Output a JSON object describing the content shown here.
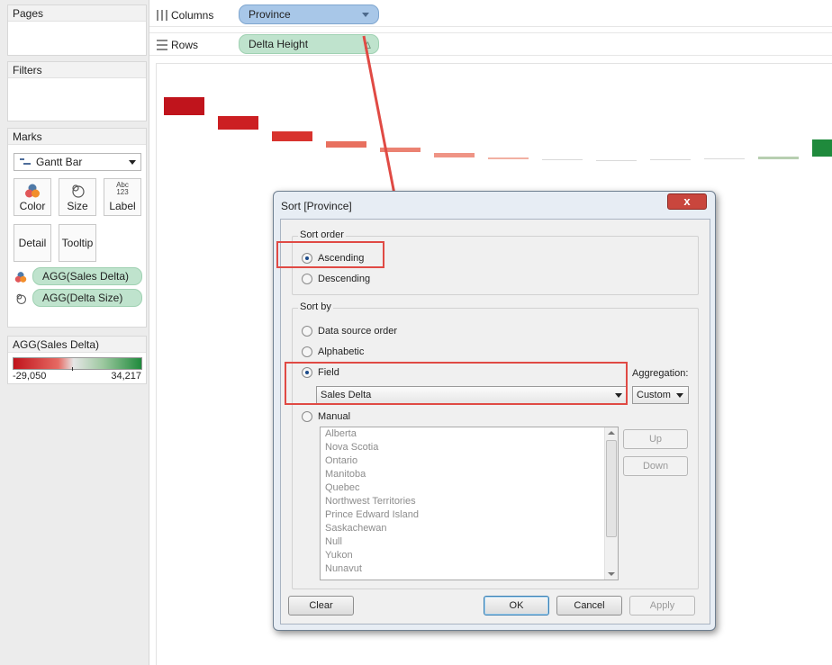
{
  "left_panel": {
    "pages_title": "Pages",
    "filters_title": "Filters",
    "marks_title": "Marks",
    "mark_type": "Gantt Bar",
    "buttons": [
      {
        "label": "Color",
        "icon": "color-icon"
      },
      {
        "label": "Size",
        "icon": "size-icon"
      },
      {
        "label": "Label",
        "icon": "label-icon",
        "icon_text": "Abc\n123"
      },
      {
        "label": "Detail"
      },
      {
        "label": "Tooltip"
      }
    ],
    "pills": [
      {
        "label": "AGG(Sales Delta)",
        "icon": "color-icon"
      },
      {
        "label": "AGG(Delta Size)",
        "icon": "size-icon"
      }
    ],
    "legend_title": "AGG(Sales Delta)",
    "legend_min": "-29,050",
    "legend_max": "34,217"
  },
  "shelves": {
    "columns_label": "Columns",
    "columns_pill": "Province",
    "rows_label": "Rows",
    "rows_pill": "Delta Height"
  },
  "viz": {
    "bars_colors": [
      "#c0141c",
      "#cc1f22",
      "#d8332e",
      "#e8705f",
      "#eb8272",
      "#ef9485",
      "#f2b0a3",
      "#d9d9d9",
      "#d9d9d9",
      "#d9d9d9",
      "#d9d9d9",
      "#b7cfb1",
      "#1f8a3c"
    ]
  },
  "dialog": {
    "title": "Sort [Province]",
    "close": "x",
    "sort_order_label": "Sort order",
    "ascending": "Ascending",
    "descending": "Descending",
    "sort_by_label": "Sort by",
    "data_source_order": "Data source order",
    "alphabetic": "Alphabetic",
    "field": "Field",
    "field_value": "Sales Delta",
    "aggregation_label": "Aggregation:",
    "aggregation_value": "Custom",
    "manual": "Manual",
    "manual_items": [
      "Alberta",
      "Nova Scotia",
      "Ontario",
      "Manitoba",
      "Quebec",
      "Northwest Territories",
      "Prince Edward Island",
      "Saskachewan",
      "Null",
      "Yukon",
      "Nunavut"
    ],
    "up": "Up",
    "down": "Down",
    "clear": "Clear",
    "ok": "OK",
    "cancel": "Cancel",
    "apply": "Apply"
  },
  "colors": {
    "annotation": "#e04a44",
    "legend_low": "#c0141c",
    "legend_high": "#1f8a3c"
  }
}
